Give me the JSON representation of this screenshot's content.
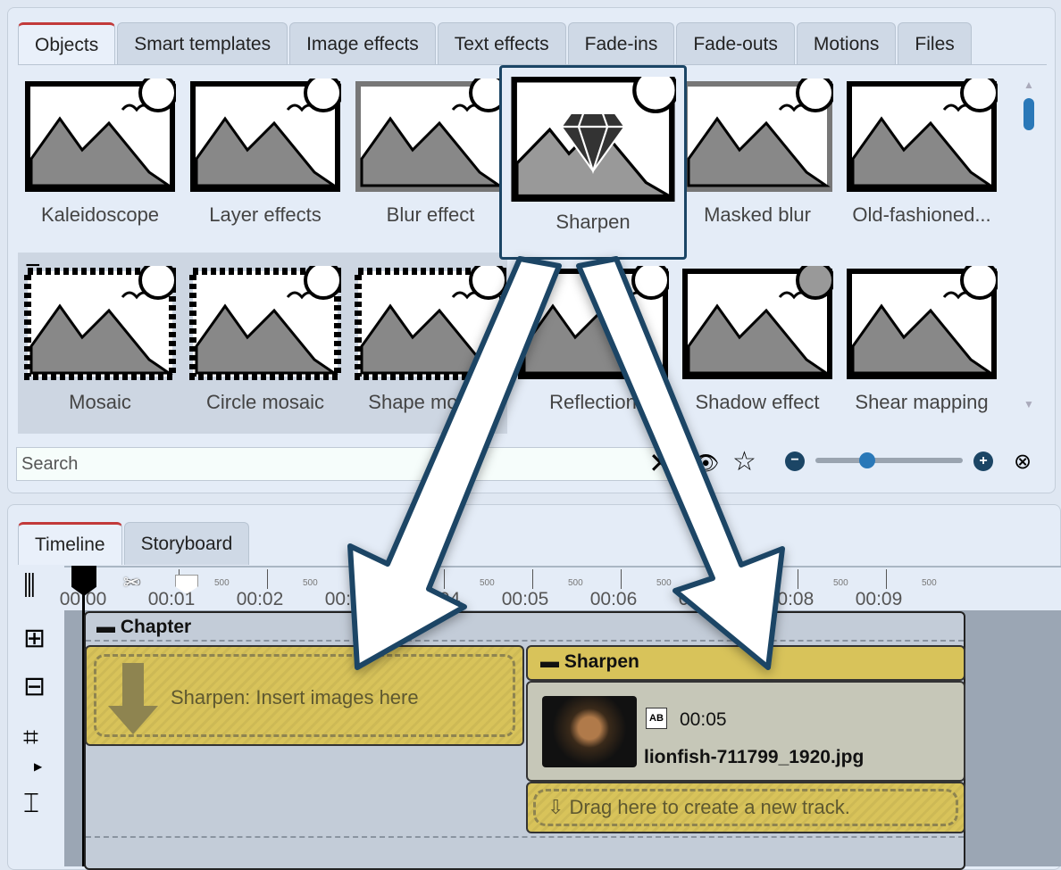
{
  "effects_panel": {
    "tabs": [
      "Objects",
      "Smart templates",
      "Image effects",
      "Text effects",
      "Fade-ins",
      "Fade-outs",
      "Motions",
      "Files"
    ],
    "active_tab": "Objects",
    "items": [
      "Kaleidoscope",
      "Layer effects",
      "Blur effect",
      "Sharpen",
      "Masked blur",
      "Old-fashioned...",
      "Mosaic",
      "Circle mosaic",
      "Shape mosaic",
      "Reflection",
      "Shadow effect",
      "Shear mapping"
    ],
    "selected_item": "Sharpen",
    "search_placeholder": "Search",
    "zoom_slider_value": 0.35
  },
  "timeline_panel": {
    "tabs": [
      "Timeline",
      "Storyboard"
    ],
    "active_tab": "Timeline",
    "ruler_labels": [
      "00:00",
      "00:01",
      "00:02",
      "00:03",
      "00:04",
      "00:05",
      "00:06",
      "00:07",
      "00:08",
      "00:09"
    ],
    "minor_label": "500",
    "chapter_title": "Chapter",
    "insert_placeholder": "Sharpen: Insert images here",
    "effect_title": "Sharpen",
    "clip": {
      "duration": "00:05",
      "filename": "lionfish-711799_1920.jpg"
    },
    "new_track_hint": "Drag here to create a new track."
  },
  "colors": {
    "accent": "#1b4565",
    "track_yellow": "#d8c35a",
    "tab_active": "#c23a3a",
    "slider": "#2a78b8"
  }
}
